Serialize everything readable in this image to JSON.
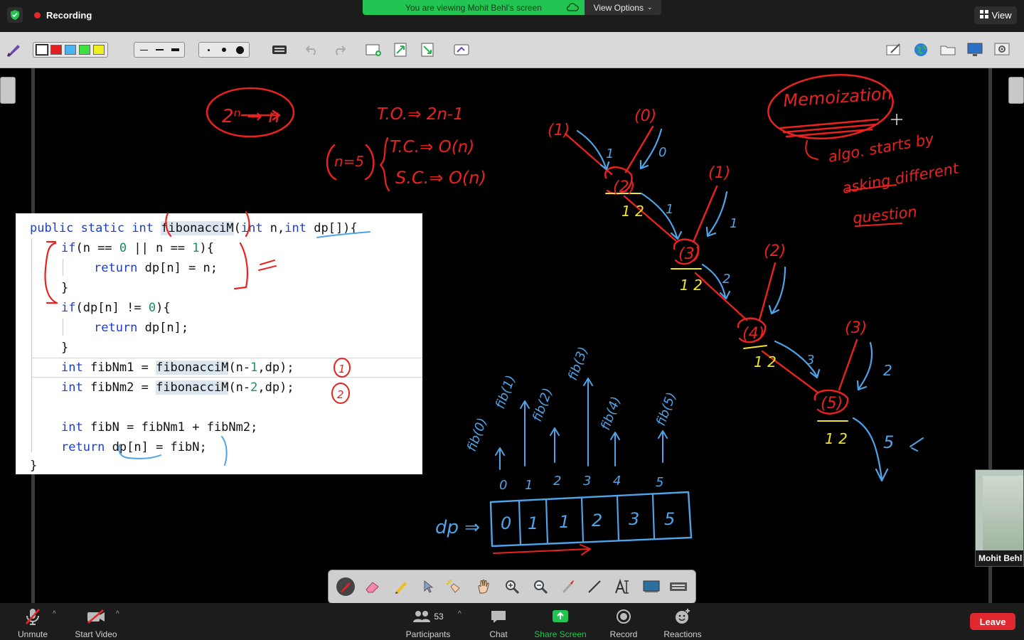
{
  "topbar": {
    "recording_label": "Recording",
    "viewing_banner": "You are viewing Mohit Behl's screen",
    "view_options_label": "View Options",
    "view_button_label": "View"
  },
  "code": {
    "lines": [
      {
        "id": "l1",
        "parts": [
          [
            "kw",
            "public static int "
          ],
          [
            "hl",
            "fibonacciM"
          ],
          [
            "",
            "("
          ],
          [
            "kw",
            "int"
          ],
          [
            "",
            " n,"
          ],
          [
            "kw",
            "int"
          ],
          [
            "",
            " dp[]){"
          ]
        ]
      },
      {
        "id": "l2",
        "parts": [
          [
            "kw",
            "if"
          ],
          [
            "",
            "(n == "
          ],
          [
            "num",
            "0"
          ],
          [
            "",
            " || n == "
          ],
          [
            "num",
            "1"
          ],
          [
            "",
            "){"
          ]
        ]
      },
      {
        "id": "l3",
        "parts": [
          [
            "kw",
            "return"
          ],
          [
            "",
            " dp[n] = n;"
          ]
        ]
      },
      {
        "id": "l4",
        "parts": [
          [
            "",
            "}"
          ]
        ]
      },
      {
        "id": "l5",
        "parts": [
          [
            "kw",
            "if"
          ],
          [
            "",
            "(dp[n] != "
          ],
          [
            "num",
            "0"
          ],
          [
            "",
            "){"
          ]
        ]
      },
      {
        "id": "l6",
        "parts": [
          [
            "kw",
            "return"
          ],
          [
            "",
            " dp[n];"
          ]
        ]
      },
      {
        "id": "l7",
        "parts": [
          [
            "",
            "}"
          ]
        ]
      },
      {
        "id": "l8",
        "parts": [
          [
            "kw",
            "int"
          ],
          [
            "",
            " fibNm1 = "
          ],
          [
            "hl",
            "fibonacciM"
          ],
          [
            "",
            "(n-"
          ],
          [
            "num",
            "1"
          ],
          [
            "",
            ",dp);"
          ]
        ]
      },
      {
        "id": "l9",
        "parts": [
          [
            "kw",
            "int"
          ],
          [
            "",
            " fibNm2 = "
          ],
          [
            "hl",
            "fibonacciM"
          ],
          [
            "",
            "(n-"
          ],
          [
            "num",
            "2"
          ],
          [
            "",
            ",dp);"
          ]
        ]
      },
      {
        "id": "l10",
        "parts": [
          [
            "kw",
            "int"
          ],
          [
            "",
            " fibN = fibNm1 + fibNm2;"
          ]
        ]
      },
      {
        "id": "l11",
        "parts": [
          [
            "kw",
            "return"
          ],
          [
            "",
            " dp[n] = fibN;"
          ]
        ]
      },
      {
        "id": "l12",
        "parts": [
          [
            "",
            "}"
          ]
        ]
      }
    ]
  },
  "handwriting": {
    "power": "2ⁿ → n",
    "n_eq": "n=5",
    "total_ops": "T.O.⇒ 2n-1",
    "time_complexity": "T.C.⇒ O(n)",
    "space_complexity": "S.C.⇒ O(n)",
    "memo_title": "Memoization",
    "memo_note_1": "algo. starts by",
    "memo_note_2": "asking different",
    "memo_note_3": "question",
    "dp_label": "dp ⇒",
    "dp_values": [
      "0",
      "1",
      "1",
      "2",
      "3",
      "5"
    ],
    "dp_indices": [
      "0",
      "1",
      "2",
      "3",
      "4",
      "5"
    ],
    "fib_labels": [
      "fib(0)",
      "fib(1)",
      "fib(2)",
      "fib(3)",
      "fib(4)",
      "fib(5)"
    ],
    "tree_nodes": [
      "(1)",
      "(0)",
      "(2)",
      "(1)",
      "(3)",
      "(2)",
      "(4)",
      "(3)",
      "(5)"
    ],
    "tree_order": "1 2",
    "tree_return_values": [
      "1",
      "0",
      "1",
      "2",
      "1",
      "3",
      "2",
      "5"
    ],
    "code_marks": [
      "1",
      "2"
    ]
  },
  "webcam": {
    "name": "Mohit Behl"
  },
  "bottombar": {
    "unmute": "Unmute",
    "start_video": "Start Video",
    "participants": "Participants",
    "participants_count": "53",
    "chat": "Chat",
    "share_screen": "Share Screen",
    "record": "Record",
    "reactions": "Reactions",
    "leave": "Leave"
  },
  "colors": {
    "ink_red": "#e8231f",
    "ink_blue": "#4fa3e8",
    "ink_yellow": "#f2e526",
    "share_green": "#23c552",
    "leave_red": "#e0282e"
  }
}
